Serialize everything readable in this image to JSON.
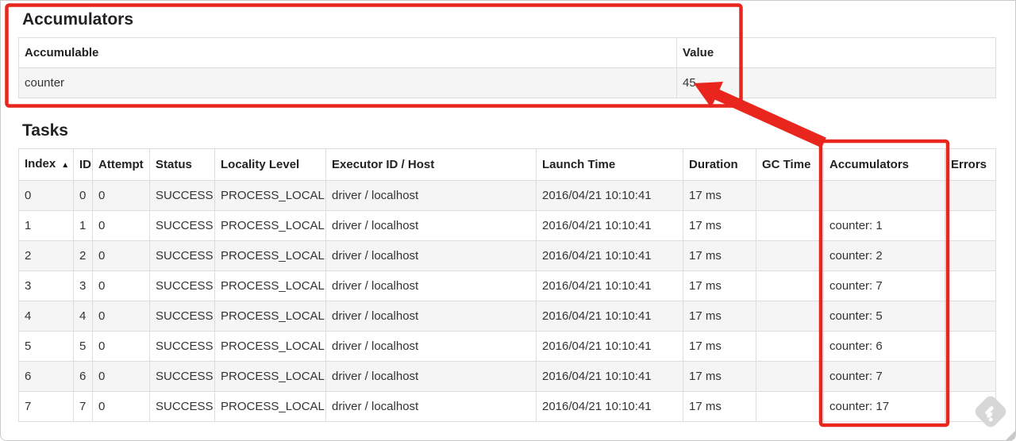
{
  "accumulators_section": {
    "heading": "Accumulators",
    "table": {
      "columns": [
        "Accumulable",
        "Value"
      ],
      "rows": [
        {
          "accumulable": "counter",
          "value": "45"
        }
      ]
    }
  },
  "tasks_section": {
    "heading": "Tasks",
    "table": {
      "sort_indicator": "▲",
      "sorted_column": "Index",
      "columns": [
        "Index",
        "ID",
        "Attempt",
        "Status",
        "Locality Level",
        "Executor ID / Host",
        "Launch Time",
        "Duration",
        "GC Time",
        "Accumulators",
        "Errors"
      ],
      "rows": [
        {
          "index": "0",
          "id": "0",
          "attempt": "0",
          "status": "SUCCESS",
          "locality": "PROCESS_LOCAL",
          "executor": "driver / localhost",
          "launch": "2016/04/21 10:10:41",
          "duration": "17 ms",
          "gc": "",
          "accumulators": "",
          "errors": ""
        },
        {
          "index": "1",
          "id": "1",
          "attempt": "0",
          "status": "SUCCESS",
          "locality": "PROCESS_LOCAL",
          "executor": "driver / localhost",
          "launch": "2016/04/21 10:10:41",
          "duration": "17 ms",
          "gc": "",
          "accumulators": "counter: 1",
          "errors": ""
        },
        {
          "index": "2",
          "id": "2",
          "attempt": "0",
          "status": "SUCCESS",
          "locality": "PROCESS_LOCAL",
          "executor": "driver / localhost",
          "launch": "2016/04/21 10:10:41",
          "duration": "17 ms",
          "gc": "",
          "accumulators": "counter: 2",
          "errors": ""
        },
        {
          "index": "3",
          "id": "3",
          "attempt": "0",
          "status": "SUCCESS",
          "locality": "PROCESS_LOCAL",
          "executor": "driver / localhost",
          "launch": "2016/04/21 10:10:41",
          "duration": "17 ms",
          "gc": "",
          "accumulators": "counter: 7",
          "errors": ""
        },
        {
          "index": "4",
          "id": "4",
          "attempt": "0",
          "status": "SUCCESS",
          "locality": "PROCESS_LOCAL",
          "executor": "driver / localhost",
          "launch": "2016/04/21 10:10:41",
          "duration": "17 ms",
          "gc": "",
          "accumulators": "counter: 5",
          "errors": ""
        },
        {
          "index": "5",
          "id": "5",
          "attempt": "0",
          "status": "SUCCESS",
          "locality": "PROCESS_LOCAL",
          "executor": "driver / localhost",
          "launch": "2016/04/21 10:10:41",
          "duration": "17 ms",
          "gc": "",
          "accumulators": "counter: 6",
          "errors": ""
        },
        {
          "index": "6",
          "id": "6",
          "attempt": "0",
          "status": "SUCCESS",
          "locality": "PROCESS_LOCAL",
          "executor": "driver / localhost",
          "launch": "2016/04/21 10:10:41",
          "duration": "17 ms",
          "gc": "",
          "accumulators": "counter: 7",
          "errors": ""
        },
        {
          "index": "7",
          "id": "7",
          "attempt": "0",
          "status": "SUCCESS",
          "locality": "PROCESS_LOCAL",
          "executor": "driver / localhost",
          "launch": "2016/04/21 10:10:41",
          "duration": "17 ms",
          "gc": "",
          "accumulators": "counter: 17",
          "errors": ""
        }
      ]
    }
  },
  "annotations": {
    "color": "#e8261d",
    "items": [
      "accumulators-summary-highlight-box",
      "tasks-accumulators-column-highlight-box",
      "arrow-to-value-45"
    ]
  },
  "watermark": {
    "icon": "feedly-watermark-icon",
    "color": "#d7d7d7"
  }
}
